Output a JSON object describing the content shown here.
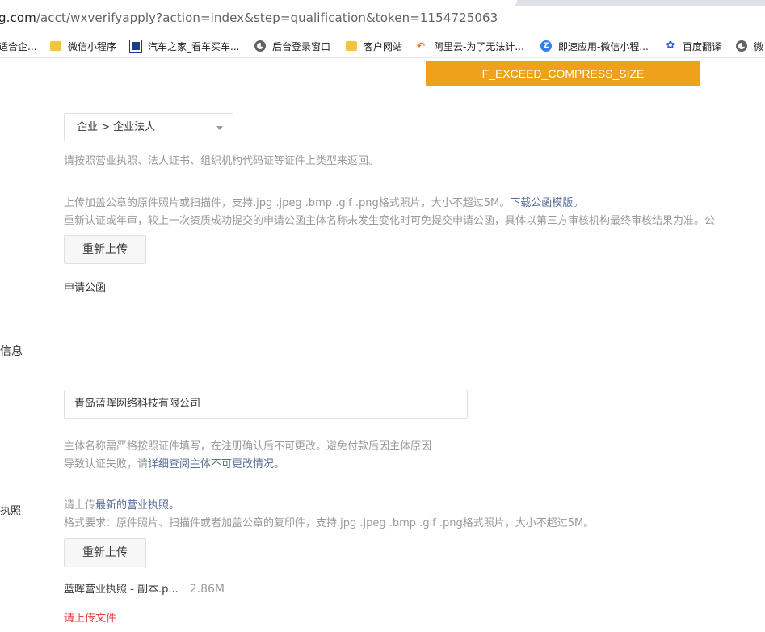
{
  "browser": {
    "url_host": "g.com",
    "url_rest": "/acct/wxverifyapply?action=index&step=qualification&token=1154725063"
  },
  "bookmarks": [
    {
      "label": "适合企...",
      "icon": "folder-icon"
    },
    {
      "label": "微信小程序",
      "icon": "folder-icon"
    },
    {
      "label": "汽车之家_看车买车...",
      "icon": "car-icon"
    },
    {
      "label": "后台登录窗口",
      "icon": "globe-icon"
    },
    {
      "label": "客户网站",
      "icon": "folder-icon"
    },
    {
      "label": "阿里云-为了无法计...",
      "icon": "aliyun-icon"
    },
    {
      "label": "即速应用-微信小程...",
      "icon": "jisu-icon"
    },
    {
      "label": "百度翻译",
      "icon": "baidu-paw-icon"
    },
    {
      "label": "微",
      "icon": "globe-icon"
    }
  ],
  "warning_banner": "F_EXCEED_COMPRESS_SIZE",
  "qualification": {
    "type_select_value": "企业 > 企业法人",
    "type_hint": "请按照营业执照、法人证书、组织机构代码证等证件上类型来返回。",
    "letter_hint_line1": "上传加盖公章的原件照片或扫描件，支持.jpg .jpeg .bmp .gif .png格式照片，大小不超过5M。",
    "letter_template_link": "下载公函模版。",
    "letter_hint_line2": "重新认证或年审，较上一次资质成功提交的申请公函主体名称未发生变化时可免提交申请公函，具体以第三方审核机构最终审核结果为准。公",
    "reupload_button": "重新上传",
    "letter_label": "申请公函"
  },
  "info_section": {
    "title": "信息",
    "entity_name_value": "青岛蓝晖网络科技有限公司",
    "entity_hint_line1": "主体名称需严格按照证件填写，在注册确认后不可更改。避免付款后因主体原因",
    "entity_hint_line2_prefix": "导致认证失败，请",
    "entity_hint_link": "详细查阅主体不可更改情况。",
    "license_label": "执照",
    "license_hint_prefix": "请上传",
    "license_hint_emph": "最新的营业执照。",
    "license_format_hint": "格式要求：原件照片、扫描件或者加盖公章的复印件，支持.jpg .jpeg .bmp .gif .png格式照片，大小不超过5M。",
    "reupload_button": "重新上传",
    "file_name": "蓝晖营业执照 - 副本.p...",
    "file_size": "2.86M",
    "error_text": "请上传文件"
  },
  "colors": {
    "warning": "#eea11a",
    "link": "#576b95",
    "error": "#e64340"
  }
}
